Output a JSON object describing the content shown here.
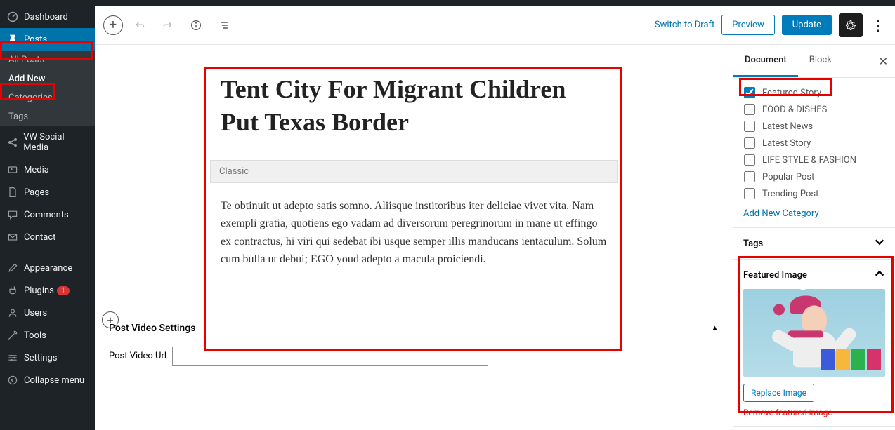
{
  "sidebar": {
    "dashboard": "Dashboard",
    "posts": "Posts",
    "all_posts": "All Posts",
    "add_new": "Add New",
    "categories": "Categories",
    "tags": "Tags",
    "vw_social": "VW Social Media",
    "media": "Media",
    "pages": "Pages",
    "comments": "Comments",
    "contact": "Contact",
    "appearance": "Appearance",
    "plugins": "Plugins",
    "plugins_badge": "1",
    "users": "Users",
    "tools": "Tools",
    "settings": "Settings",
    "collapse": "Collapse menu"
  },
  "toolbar": {
    "switch_draft": "Switch to Draft",
    "preview": "Preview",
    "update": "Update"
  },
  "post": {
    "title": "Tent City For Migrant Children Put Texas Border",
    "block_type": "Classic",
    "content": "Te obtinuit ut adepto satis somno. Aliisque institoribus iter deliciae vivet vita. Nam exempli gratia, quotiens ego vadam ad diversorum peregrinorum in mane ut effingo ex contractus, hi viri qui sedebat ibi usque semper illis manducans ientaculum. Solum cum bulla ut debui; EGO youd adepto a macula proiciendi."
  },
  "meta": {
    "panel_title": "Post Video Settings",
    "video_url_label": "Post Video Url",
    "video_url_value": ""
  },
  "settings": {
    "tab_document": "Document",
    "tab_block": "Block",
    "categories": [
      {
        "label": "Featured Story",
        "checked": true
      },
      {
        "label": "FOOD & DISHES",
        "checked": false
      },
      {
        "label": "Latest News",
        "checked": false
      },
      {
        "label": "Latest Story",
        "checked": false
      },
      {
        "label": "LIFE STYLE & FASHION",
        "checked": false
      },
      {
        "label": "Popular Post",
        "checked": false
      },
      {
        "label": "Trending Post",
        "checked": false
      }
    ],
    "add_category": "Add New Category",
    "tags_label": "Tags",
    "featured_image_label": "Featured Image",
    "replace_image": "Replace Image",
    "remove_image": "Remove featured image"
  }
}
